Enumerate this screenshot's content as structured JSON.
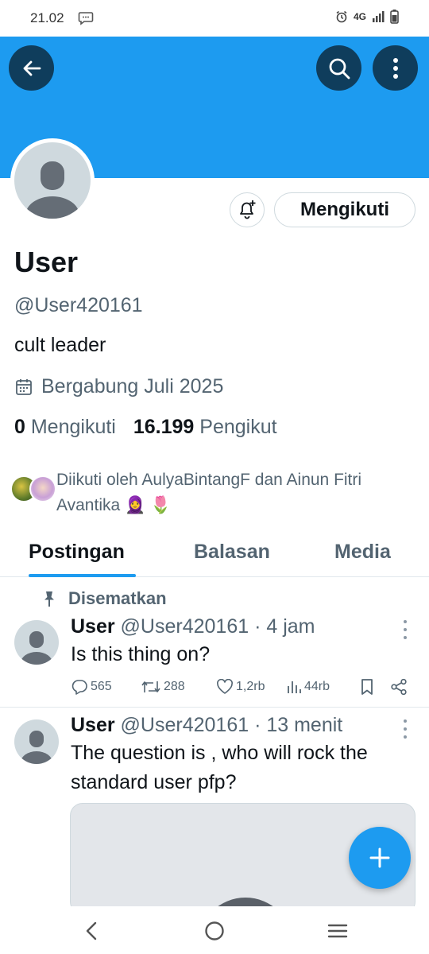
{
  "status_bar": {
    "time": "21.02",
    "network": "4G"
  },
  "profile": {
    "display_name": "User",
    "handle": "@User420161",
    "bio": "cult leader",
    "joined": "Bergabung Juli 2025",
    "following_count": "0",
    "following_label": "Mengikuti",
    "followers_count": "16.199",
    "followers_label": "Pengikut",
    "follow_button": "Mengikuti",
    "followed_by_text": "Diikuti oleh AulyaBintangF dan Ainun Fitri Avantika 🧕 🌷"
  },
  "tabs": [
    {
      "label": "Postingan",
      "active": true
    },
    {
      "label": "Balasan",
      "active": false
    },
    {
      "label": "Media",
      "active": false
    }
  ],
  "pinned_label": "Disematkan",
  "tweets": [
    {
      "name": "User",
      "meta": "@User420161 · 4 jam",
      "text": "Is this thing on?",
      "replies": "565",
      "retweets": "288",
      "likes": "1,2rb",
      "views": "44rb"
    },
    {
      "name": "User",
      "meta": "@User420161 · 13 menit",
      "text": "The question is , who will rock the standard user pfp?"
    }
  ],
  "colors": {
    "accent": "#1d9bf0",
    "dark_button": "#0f3d5c"
  }
}
